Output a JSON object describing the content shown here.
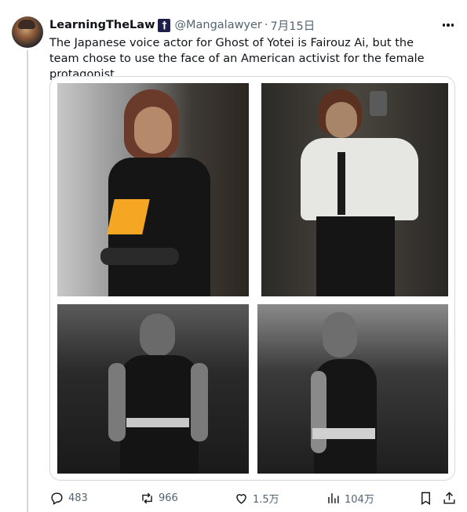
{
  "post": {
    "display_name": "LearningTheLaw",
    "badge": "†",
    "handle": "@Mangalawyer",
    "separator": "·",
    "date": "7月15日",
    "text": "The Japanese voice actor for Ghost of Yotei is Fairouz Ai, but the team chose to use the face of an American activist for the female protagonist."
  },
  "icons": [
    "more-icon",
    "reply-icon",
    "repost-icon",
    "like-icon",
    "views-icon",
    "bookmark-icon",
    "share-icon"
  ],
  "actions": {
    "replies": "483",
    "reposts": "966",
    "likes": "1.5万",
    "views": "104万"
  },
  "colors": {
    "text": "#0f1419",
    "secondary": "#536471",
    "border": "#cfd9de",
    "badge_bg": "#1d1f4a",
    "accent_orange": "#f5a623"
  }
}
